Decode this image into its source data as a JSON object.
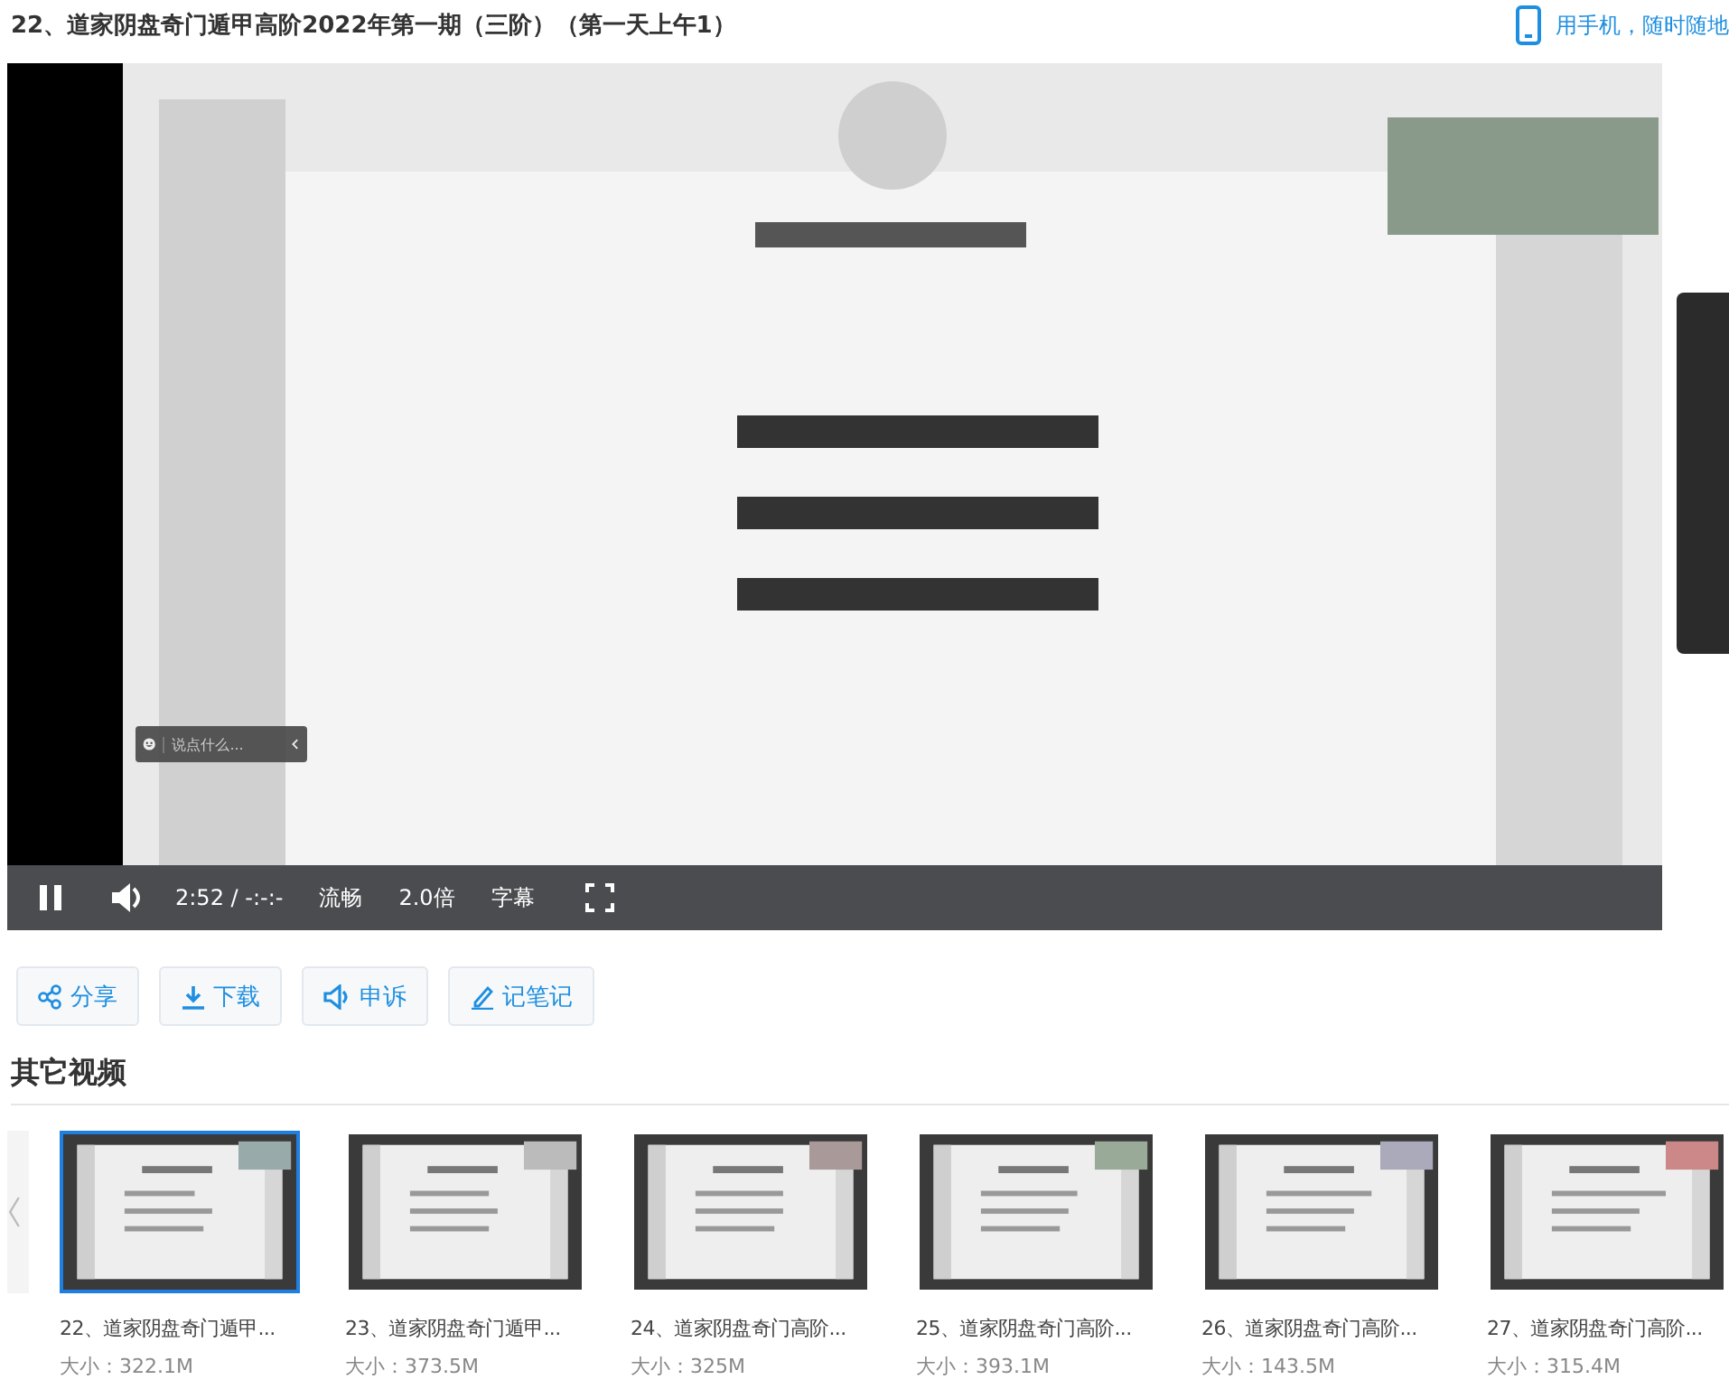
{
  "header": {
    "title": "22、道家阴盘奇门遁甲高阶2022年第一期（三阶）（第一天上午1）",
    "mobile_link": "用手机，随时随地"
  },
  "player": {
    "comment_placeholder": "说点什么...",
    "playing": true,
    "time": "2:52",
    "separator": "/",
    "duration": "-:-:-",
    "quality": "流畅",
    "speed": "2.0倍",
    "subtitles": "字幕"
  },
  "actions": [
    {
      "label": "分享",
      "kind": "share"
    },
    {
      "label": "下载",
      "kind": "download"
    },
    {
      "label": "申诉",
      "kind": "complain"
    },
    {
      "label": "记笔记",
      "kind": "note"
    }
  ],
  "other_videos": {
    "heading": "其它视频",
    "items": [
      {
        "title": "22、道家阴盘奇门遁甲...",
        "size": "大小：322.1M",
        "selected": true
      },
      {
        "title": "23、道家阴盘奇门遁甲...",
        "size": "大小：373.5M",
        "selected": false
      },
      {
        "title": "24、道家阴盘奇门高阶...",
        "size": "大小：325M",
        "selected": false
      },
      {
        "title": "25、道家阴盘奇门高阶...",
        "size": "大小：393.1M",
        "selected": false
      },
      {
        "title": "26、道家阴盘奇门高阶...",
        "size": "大小：143.5M",
        "selected": false
      },
      {
        "title": "27、道家阴盘奇门高阶...",
        "size": "大小：315.4M",
        "selected": false
      }
    ]
  }
}
